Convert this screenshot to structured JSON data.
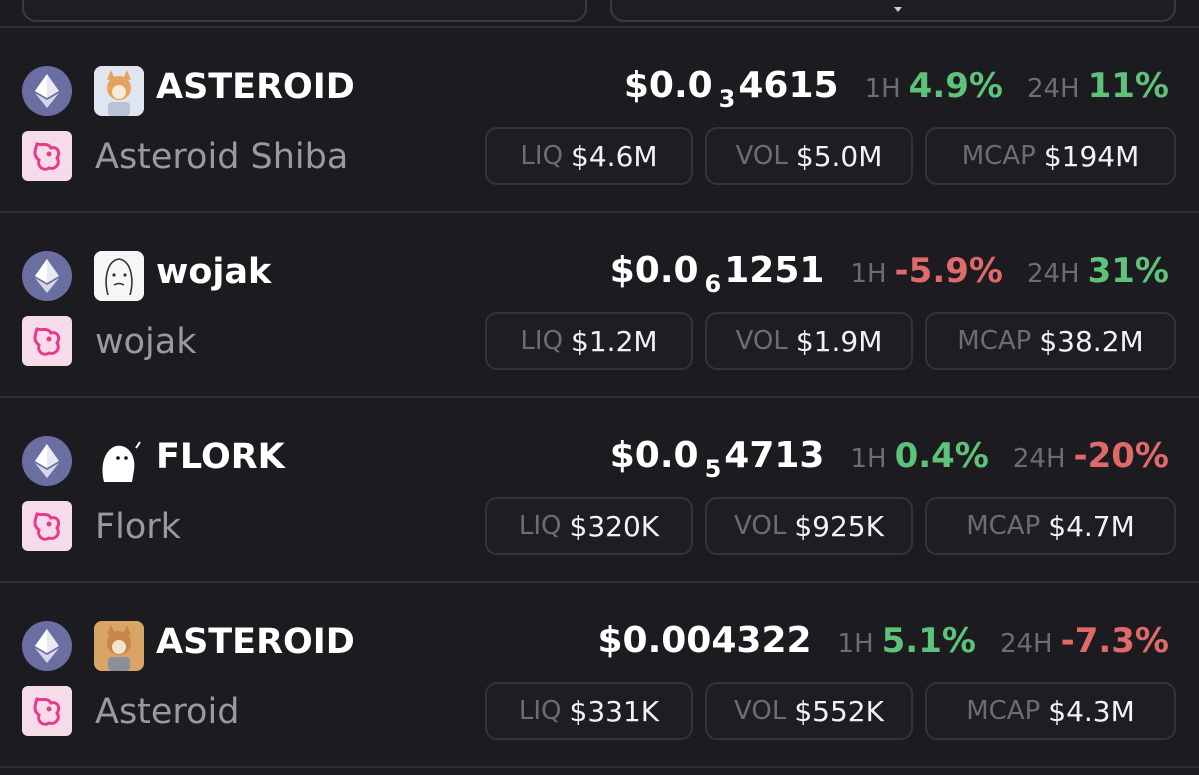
{
  "colors": {
    "background": "#1c1b20",
    "positive": "#5ec27a",
    "negative": "#e0696a",
    "chain": "#6b6ea0",
    "dex": "#f6dbe9",
    "dex_accent": "#e8388f"
  },
  "labels": {
    "h1": "1H",
    "h24": "24H",
    "liq": "LIQ",
    "vol": "VOL",
    "mcap": "MCAP"
  },
  "tokens": [
    {
      "chain_icon": "ethereum-icon",
      "dex_icon": "uniswap-icon",
      "symbol": "ASTEROID",
      "name": "Asteroid Shiba",
      "price_prefix": "$0.0",
      "price_zeros": "3",
      "price_digits": "4615",
      "h1": "4.9%",
      "h1_dir": "pos",
      "h24": "11%",
      "h24_dir": "pos",
      "liq": "$4.6M",
      "vol": "$5.0M",
      "mcap": "$194M"
    },
    {
      "chain_icon": "ethereum-icon",
      "dex_icon": "uniswap-icon",
      "symbol": "wojak",
      "name": "wojak",
      "price_prefix": "$0.0",
      "price_zeros": "6",
      "price_digits": "1251",
      "h1": "-5.9%",
      "h1_dir": "neg",
      "h24": "31%",
      "h24_dir": "pos",
      "liq": "$1.2M",
      "vol": "$1.9M",
      "mcap": "$38.2M"
    },
    {
      "chain_icon": "ethereum-icon",
      "dex_icon": "uniswap-icon",
      "symbol": "FLORK",
      "name": "Flork",
      "price_prefix": "$0.0",
      "price_zeros": "5",
      "price_digits": "4713",
      "h1": "0.4%",
      "h1_dir": "pos",
      "h24": "-20%",
      "h24_dir": "neg",
      "liq": "$320K",
      "vol": "$925K",
      "mcap": "$4.7M"
    },
    {
      "chain_icon": "ethereum-icon",
      "dex_icon": "uniswap-icon",
      "symbol": "ASTEROID",
      "name": "Asteroid",
      "price_prefix": "$0.004322",
      "price_zeros": "",
      "price_digits": "",
      "h1": "5.1%",
      "h1_dir": "pos",
      "h24": "-7.3%",
      "h24_dir": "neg",
      "liq": "$331K",
      "vol": "$552K",
      "mcap": "$4.3M"
    }
  ]
}
